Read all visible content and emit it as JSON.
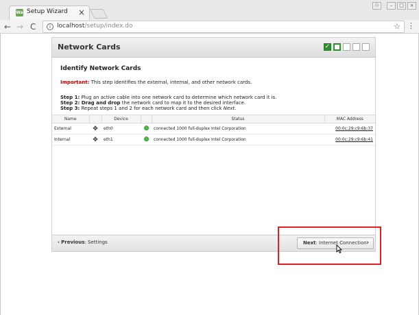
{
  "browser": {
    "tab_title": "Setup Wizard",
    "tab_close": "×",
    "favicon_text": "Wa",
    "url_host": "localhost",
    "url_path": "/setup/index.do",
    "back_icon": "←",
    "forward_icon": "→",
    "reload_icon": "C",
    "info_icon": "i",
    "star_icon": "☆",
    "menu_icon": "⋮",
    "window_buttons": {
      "user": "⚇",
      "minimize": "–",
      "maximize": "□",
      "close": "×"
    }
  },
  "wizard": {
    "title": "Network Cards",
    "step_done_mark": "✓",
    "steps": [
      "done",
      "current",
      "pending",
      "pending",
      "pending"
    ],
    "subtitle": "Identify Network Cards",
    "important_label": "Important:",
    "important_text": " This step identifies the external, internal, and other network cards.",
    "step1_label": "Step 1:",
    "step1_text": " Plug an active cable into one network card to determine which network card it is.",
    "step2_label": "Step 2: Drag and drop",
    "step2_text": " the network card to map it to the desired interface.",
    "step3_label": "Step 3:",
    "step3_text": " Repeat steps 1 and 2 for each network card and then click ",
    "step3_next": "Next",
    "step3_end": ".",
    "table": {
      "headers": [
        "Name",
        "",
        "Device",
        "",
        "Status",
        "MAC Address"
      ],
      "rows": [
        {
          "name": "External",
          "drag": "✥",
          "device": "eth0",
          "status": "connected 1000 full-duplex Intel Corporation",
          "mac": "00:0c:29:c9:6b:37"
        },
        {
          "name": "Internal",
          "drag": "✥",
          "device": "eth1",
          "status": "connected 1000 full-duplex Intel Corporation",
          "mac": "00:0c:29:c9:6b:41"
        }
      ]
    },
    "footer": {
      "prev_chevron": "‹",
      "prev_label": "Previous",
      "prev_target": ": Settings",
      "next_label": "Next",
      "next_target": ": Internet Connection",
      "next_chevron": "›"
    }
  },
  "colors": {
    "accent_green": "#2f8f2f",
    "important_red": "#cc0000",
    "highlight_red": "#e02020",
    "link_blue": "#1a3fa0"
  }
}
